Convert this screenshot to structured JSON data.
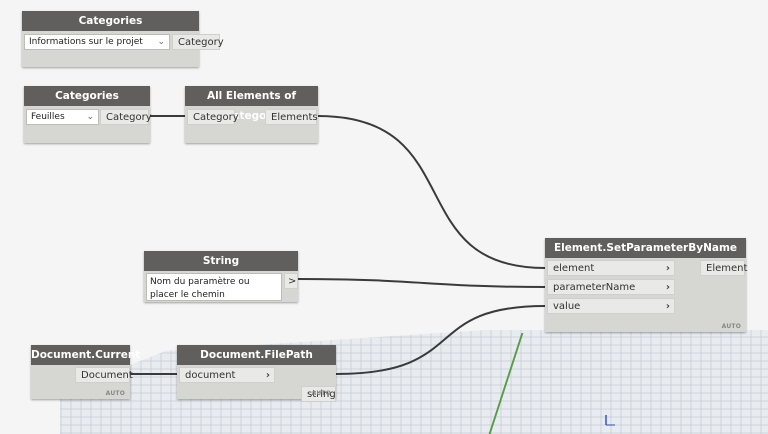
{
  "nodes": {
    "categories_project": {
      "title": "Categories",
      "dropdown_value": "Informations sur le projet",
      "output": "Category"
    },
    "categories_sheets": {
      "title": "Categories",
      "dropdown_value": "Feuilles",
      "output": "Category"
    },
    "all_elements": {
      "title": "All Elements of Category",
      "input": "Category",
      "output": "Elements"
    },
    "string_node": {
      "title": "String",
      "text_value": "Nom du paramètre ou placer le chemin",
      "output_symbol": ">"
    },
    "set_param": {
      "title": "Element.SetParameterByName",
      "inputs": [
        "element",
        "parameterName",
        "value"
      ],
      "output": "Element",
      "lacing": "AUTO"
    },
    "doc_current": {
      "title": "Document.Current",
      "output": "Document",
      "lacing": "AUTO"
    },
    "doc_filepath": {
      "title": "Document.FilePath",
      "input": "document",
      "output": "string",
      "lacing": "AUTO"
    }
  },
  "icons": {
    "input_arrow": "›",
    "dropdown_chevron": "⌄"
  },
  "colors": {
    "header": "#605f5d",
    "node_body": "#d6d6d2",
    "wire": "#3a3a3a",
    "canvas": "#f5f5f5"
  }
}
